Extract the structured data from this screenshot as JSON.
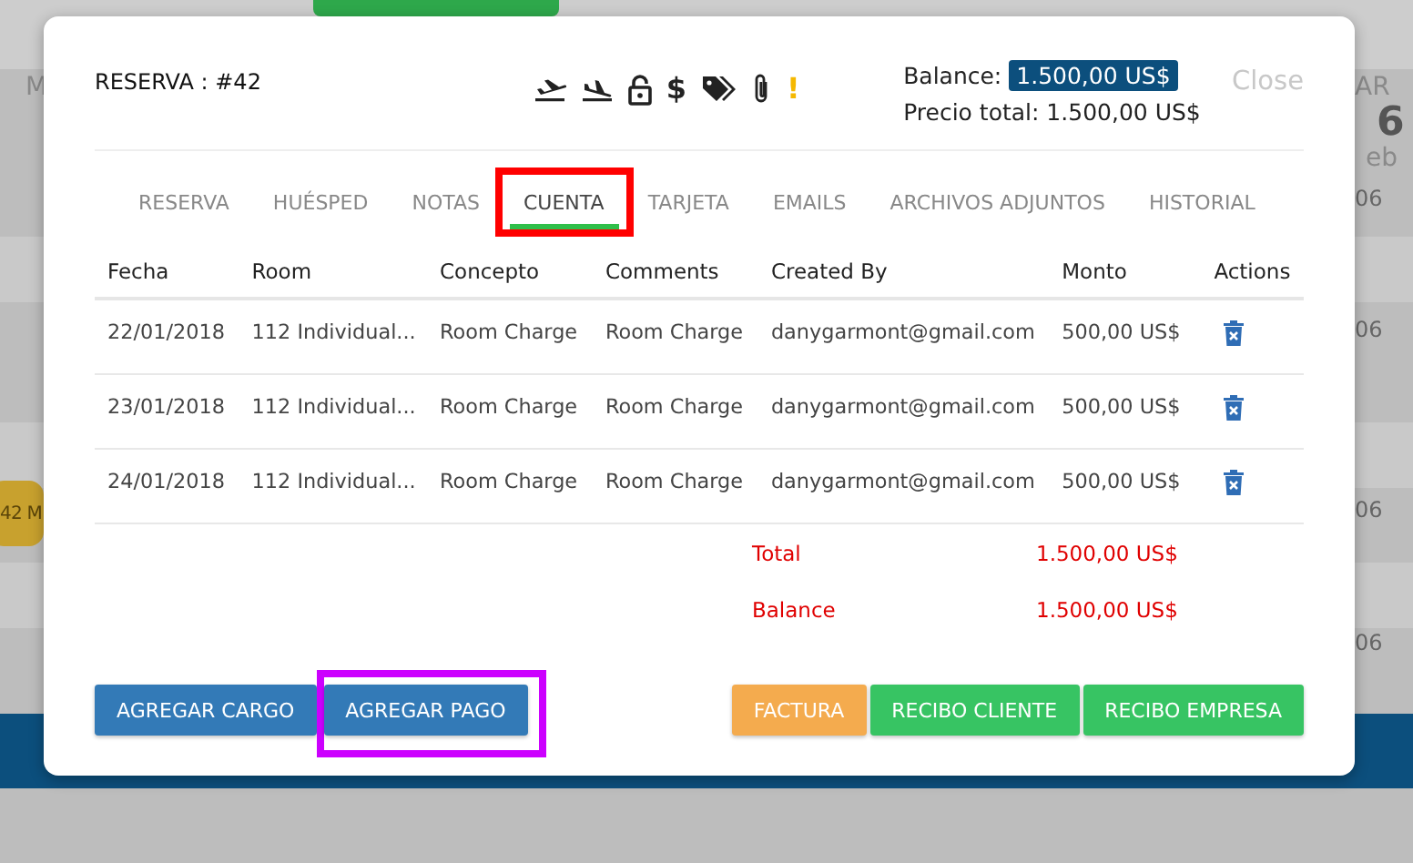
{
  "backdrop": {
    "left_fragments": [
      "M"
    ],
    "right_header": [
      "AR",
      "6",
      "eb"
    ],
    "right_cells": [
      "06",
      "06",
      "06",
      "06"
    ],
    "badge": "42 M"
  },
  "modal": {
    "title": "RESERVA : #42",
    "icons": [
      {
        "kind": "takeoff"
      },
      {
        "kind": "landing"
      },
      {
        "kind": "lock"
      },
      {
        "kind": "dollar",
        "text": "$"
      },
      {
        "kind": "tags"
      },
      {
        "kind": "clip"
      },
      {
        "kind": "alert",
        "text": "!"
      }
    ],
    "balance_label": "Balance:",
    "balance_value": "1.500,00 US$",
    "total_price": "Precio total: 1.500,00 US$",
    "close": "Close",
    "tabs": [
      {
        "label": "RESERVA",
        "selected": false
      },
      {
        "label": "HUÉSPED",
        "selected": false
      },
      {
        "label": "NOTAS",
        "selected": false
      },
      {
        "label": "CUENTA",
        "selected": true,
        "highlight": {
          "color": "#ff0000"
        }
      },
      {
        "label": "TARJETA",
        "selected": false
      },
      {
        "label": "EMAILS",
        "selected": false
      },
      {
        "label": "ARCHIVOS ADJUNTOS",
        "selected": false
      },
      {
        "label": "HISTORIAL",
        "selected": false
      }
    ],
    "table": {
      "columns": [
        "Fecha",
        "Room",
        "Concepto",
        "Comments",
        "Created By",
        "Monto",
        "Actions"
      ],
      "rows": [
        {
          "fecha": "22/01/2018",
          "room": "112 Individual...",
          "concepto": "Room Charge",
          "comments": "Room Charge",
          "created_by": "danygarmont@gmail.com",
          "monto": "500,00 US$"
        },
        {
          "fecha": "23/01/2018",
          "room": "112 Individual...",
          "concepto": "Room Charge",
          "comments": "Room Charge",
          "created_by": "danygarmont@gmail.com",
          "monto": "500,00 US$"
        },
        {
          "fecha": "24/01/2018",
          "room": "112 Individual...",
          "concepto": "Room Charge",
          "comments": "Room Charge",
          "created_by": "danygarmont@gmail.com",
          "monto": "500,00 US$"
        }
      ]
    },
    "summary": [
      {
        "label": "Total",
        "value": "1.500,00 US$"
      },
      {
        "label": "Balance",
        "value": "1.500,00 US$"
      }
    ],
    "left_buttons": [
      {
        "label": "AGREGAR CARGO",
        "kind": "primary"
      },
      {
        "label": "AGREGAR PAGO",
        "kind": "primary",
        "highlight": {
          "color": "#cc00ff"
        }
      }
    ],
    "right_buttons": [
      {
        "label": "FACTURA",
        "kind": "warning"
      },
      {
        "label": "RECIBO CLIENTE",
        "kind": "success"
      },
      {
        "label": "RECIBO EMPRESA",
        "kind": "success"
      }
    ]
  }
}
